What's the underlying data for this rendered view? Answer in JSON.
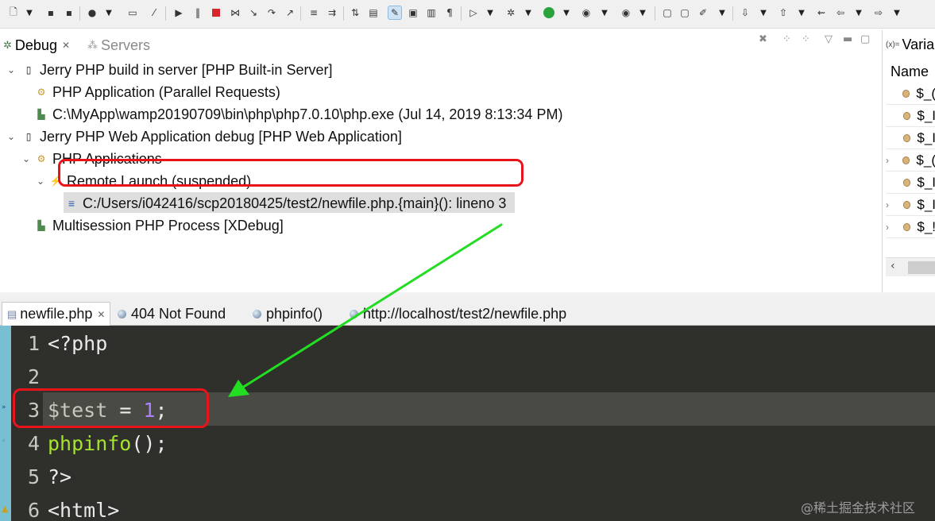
{
  "debug_view": {
    "tabs": [
      {
        "label": "Debug",
        "icon": "debug-icon",
        "active": true
      },
      {
        "label": "Servers",
        "icon": "servers-icon",
        "active": false
      }
    ],
    "tree": [
      {
        "label": "Jerry PHP build in server [PHP Built-in Server]",
        "icon": "launch-config-icon",
        "expanded": true
      },
      {
        "label": "PHP Application (Parallel Requests)",
        "icon": "php-app-icon"
      },
      {
        "label": "C:\\MyApp\\wamp20190709\\bin\\php\\php7.0.10\\php.exe (Jul 14, 2019 8:13:34 PM)",
        "icon": "process-icon"
      },
      {
        "label": "Jerry PHP Web Application debug [PHP Web Application]",
        "icon": "launch-config-icon",
        "expanded": true
      },
      {
        "label": "PHP Applications",
        "icon": "php-app-icon",
        "expanded": true
      },
      {
        "label": "Remote Launch (suspended)",
        "icon": "thread-suspended-icon",
        "expanded": true
      },
      {
        "label": "C:/Users/i042416/scp20180425/test2/newfile.php.{main}(): lineno 3",
        "icon": "stack-frame-icon",
        "selected": true
      },
      {
        "label": "Multisession PHP Process [XDebug]",
        "icon": "process-icon"
      }
    ]
  },
  "variables_view": {
    "tab_label": "Varial",
    "tab_prefix": "(x)=",
    "column_header": "Name",
    "rows": [
      "$_(",
      "$_I",
      "$_I",
      "$_(",
      "$_I",
      "$_I",
      "$_!"
    ]
  },
  "editor": {
    "tabs": [
      {
        "label": "newfile.php",
        "active": true
      },
      {
        "label": "404 Not Found"
      },
      {
        "label": "phpinfo()"
      },
      {
        "label": "http://localhost/test2/newfile.php"
      }
    ],
    "lines": [
      {
        "number": "1",
        "text": "<?php"
      },
      {
        "number": "2",
        "text": ""
      },
      {
        "number": "3",
        "text_var": "$test",
        "text_op": " = ",
        "text_num": "1",
        "text_end": ";"
      },
      {
        "number": "4",
        "text_fn": "phpinfo",
        "text_end": "();"
      },
      {
        "number": "5",
        "text": "?>"
      },
      {
        "number": "6",
        "text": "<html>"
      }
    ],
    "current_line": "3"
  },
  "colors": {
    "annotation_red": "#e8141c",
    "arrow_green": "#22dd22",
    "editor_bg": "#2f2f2b",
    "php_function": "#a6e22e",
    "php_number": "#ae81ff"
  },
  "watermark": "@稀土掘金技术社区"
}
